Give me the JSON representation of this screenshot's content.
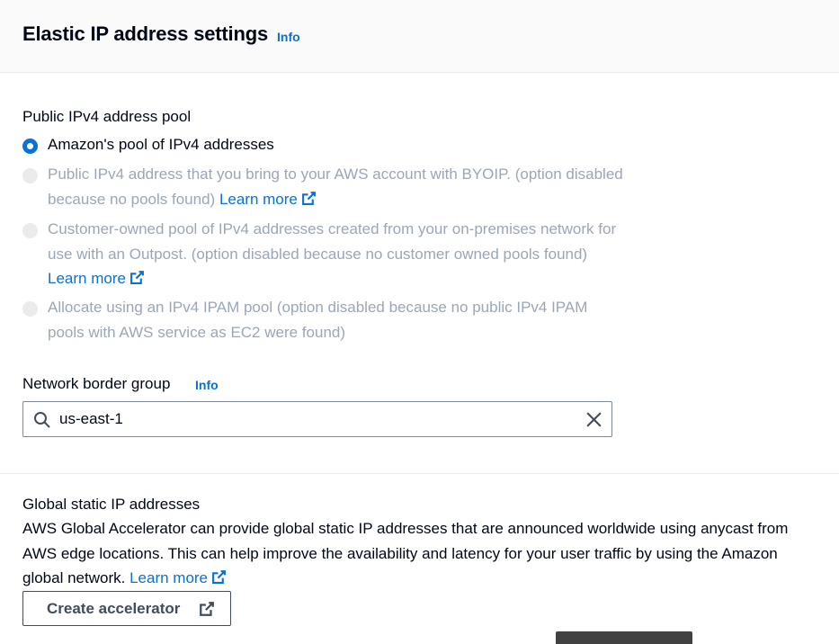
{
  "header": {
    "title": "Elastic IP address settings",
    "info": "Info"
  },
  "pool": {
    "label": "Public IPv4 address pool",
    "options": [
      {
        "text": "Amazon's pool of IPv4 addresses",
        "selected": true,
        "disabled": false
      },
      {
        "text": "Public IPv4 address that you bring to your AWS account with BYOIP. (option disabled because no pools found)",
        "learn_more": "Learn more",
        "selected": false,
        "disabled": true
      },
      {
        "text": "Customer-owned pool of IPv4 addresses created from your on-premises network for use with an Outpost. (option disabled because no customer owned pools found)",
        "learn_more": "Learn more",
        "selected": false,
        "disabled": true
      },
      {
        "text": "Allocate using an IPv4 IPAM pool (option disabled because no public IPv4 IPAM pools with AWS service as EC2 were found)",
        "selected": false,
        "disabled": true
      }
    ]
  },
  "network_border_group": {
    "label": "Network border group",
    "info": "Info",
    "value": "us-east-1"
  },
  "global_static": {
    "label": "Global static IP addresses",
    "description": "AWS Global Accelerator can provide global static IP addresses that are announced worldwide using anycast from AWS edge locations. This can help improve the availability and latency for your user traffic by using the Amazon global network.",
    "learn_more": "Learn more",
    "button": "Create accelerator"
  },
  "colors": {
    "link": "#0972d3",
    "disabled_text": "#9ba7b6",
    "text": "#000716"
  }
}
